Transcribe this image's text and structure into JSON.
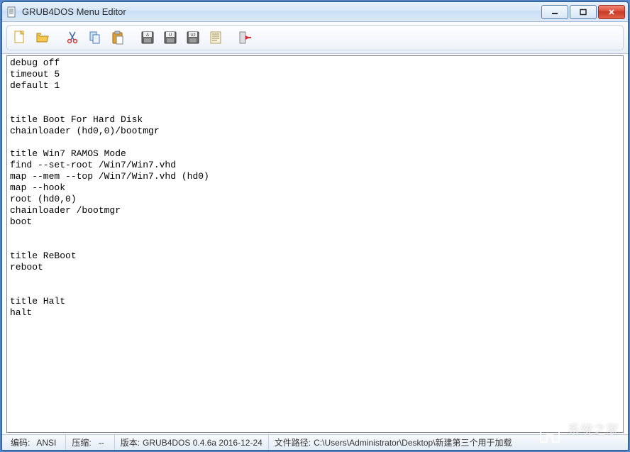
{
  "window": {
    "title": "GRUB4DOS Menu Editor"
  },
  "toolbar": {
    "items": [
      {
        "name": "new-file-icon"
      },
      {
        "name": "open-file-icon"
      },
      {
        "name": "sep"
      },
      {
        "name": "cut-icon"
      },
      {
        "name": "copy-icon"
      },
      {
        "name": "paste-icon"
      },
      {
        "name": "sep"
      },
      {
        "name": "save-a-icon"
      },
      {
        "name": "save-u-icon"
      },
      {
        "name": "save-u2-icon"
      },
      {
        "name": "document-icon"
      },
      {
        "name": "sep"
      },
      {
        "name": "exit-icon"
      }
    ]
  },
  "editor": {
    "content": "debug off\ntimeout 5\ndefault 1\n\n\ntitle Boot For Hard Disk\nchainloader (hd0,0)/bootmgr\n\ntitle Win7 RAMOS Mode\nfind --set-root /Win7/Win7.vhd\nmap --mem --top /Win7/Win7.vhd (hd0)\nmap --hook\nroot (hd0,0)\nchainloader /bootmgr\nboot\n\n\ntitle ReBoot\nreboot\n\n\ntitle Halt\nhalt\n\n"
  },
  "statusbar": {
    "encoding_label": "编码:",
    "encoding_value": "ANSI",
    "compress_label": "压缩:",
    "compress_value": "--",
    "version_label": "版本:",
    "version_value": "GRUB4DOS 0.4.6a 2016-12-24",
    "path_label": "文件路径:",
    "path_value": "C:\\Users\\Administrator\\Desktop\\新建第三个用于加载"
  },
  "watermark": {
    "text": "系统之家"
  }
}
